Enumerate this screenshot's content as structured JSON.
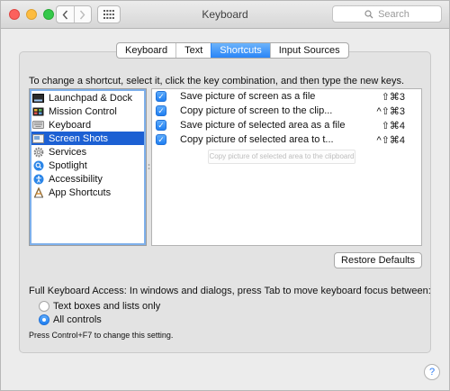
{
  "window": {
    "title": "Keyboard"
  },
  "search": {
    "placeholder": "Search"
  },
  "tabs": [
    {
      "label": "Keyboard"
    },
    {
      "label": "Text"
    },
    {
      "label": "Shortcuts"
    },
    {
      "label": "Input Sources"
    }
  ],
  "active_tab": "Shortcuts",
  "instructions": "To change a shortcut, select it, click the key combination, and then type the new keys.",
  "categories": [
    {
      "label": "Launchpad & Dock",
      "icon": "launchpad-dock-icon"
    },
    {
      "label": "Mission Control",
      "icon": "mission-control-icon"
    },
    {
      "label": "Keyboard",
      "icon": "keyboard-icon"
    },
    {
      "label": "Screen Shots",
      "icon": "screenshot-icon"
    },
    {
      "label": "Services",
      "icon": "gear-icon"
    },
    {
      "label": "Spotlight",
      "icon": "spotlight-icon"
    },
    {
      "label": "Accessibility",
      "icon": "accessibility-icon"
    },
    {
      "label": "App Shortcuts",
      "icon": "app-shortcuts-icon"
    }
  ],
  "selected_category": "Screen Shots",
  "shortcuts": [
    {
      "checked": true,
      "label": "Save picture of screen as a file",
      "keys": "⇧⌘3",
      "indent": false
    },
    {
      "checked": true,
      "label": "Copy picture of screen to the clip...",
      "keys": "^⇧⌘3",
      "indent": true
    },
    {
      "checked": true,
      "label": "Save picture of selected area as a file",
      "keys": "⇧⌘4",
      "indent": false
    },
    {
      "checked": true,
      "label": "Copy picture of selected area to t...",
      "keys": "^⇧⌘4",
      "indent": true
    }
  ],
  "tooltip": "Copy picture of selected area to the clipboard",
  "restore_button": "Restore Defaults",
  "keyboard_access": {
    "label": "Full Keyboard Access: In windows and dialogs, press Tab to move keyboard focus between:",
    "options": [
      {
        "label": "Text boxes and lists only",
        "selected": false
      },
      {
        "label": "All controls",
        "selected": true
      }
    ],
    "hint": "Press Control+F7 to change this setting."
  },
  "help_label": "?",
  "colors": {
    "accent": "#2a85f7",
    "selection": "#1c60d3",
    "close": "#fc615d",
    "minimize": "#fdbc40",
    "maximize": "#34c84a"
  }
}
